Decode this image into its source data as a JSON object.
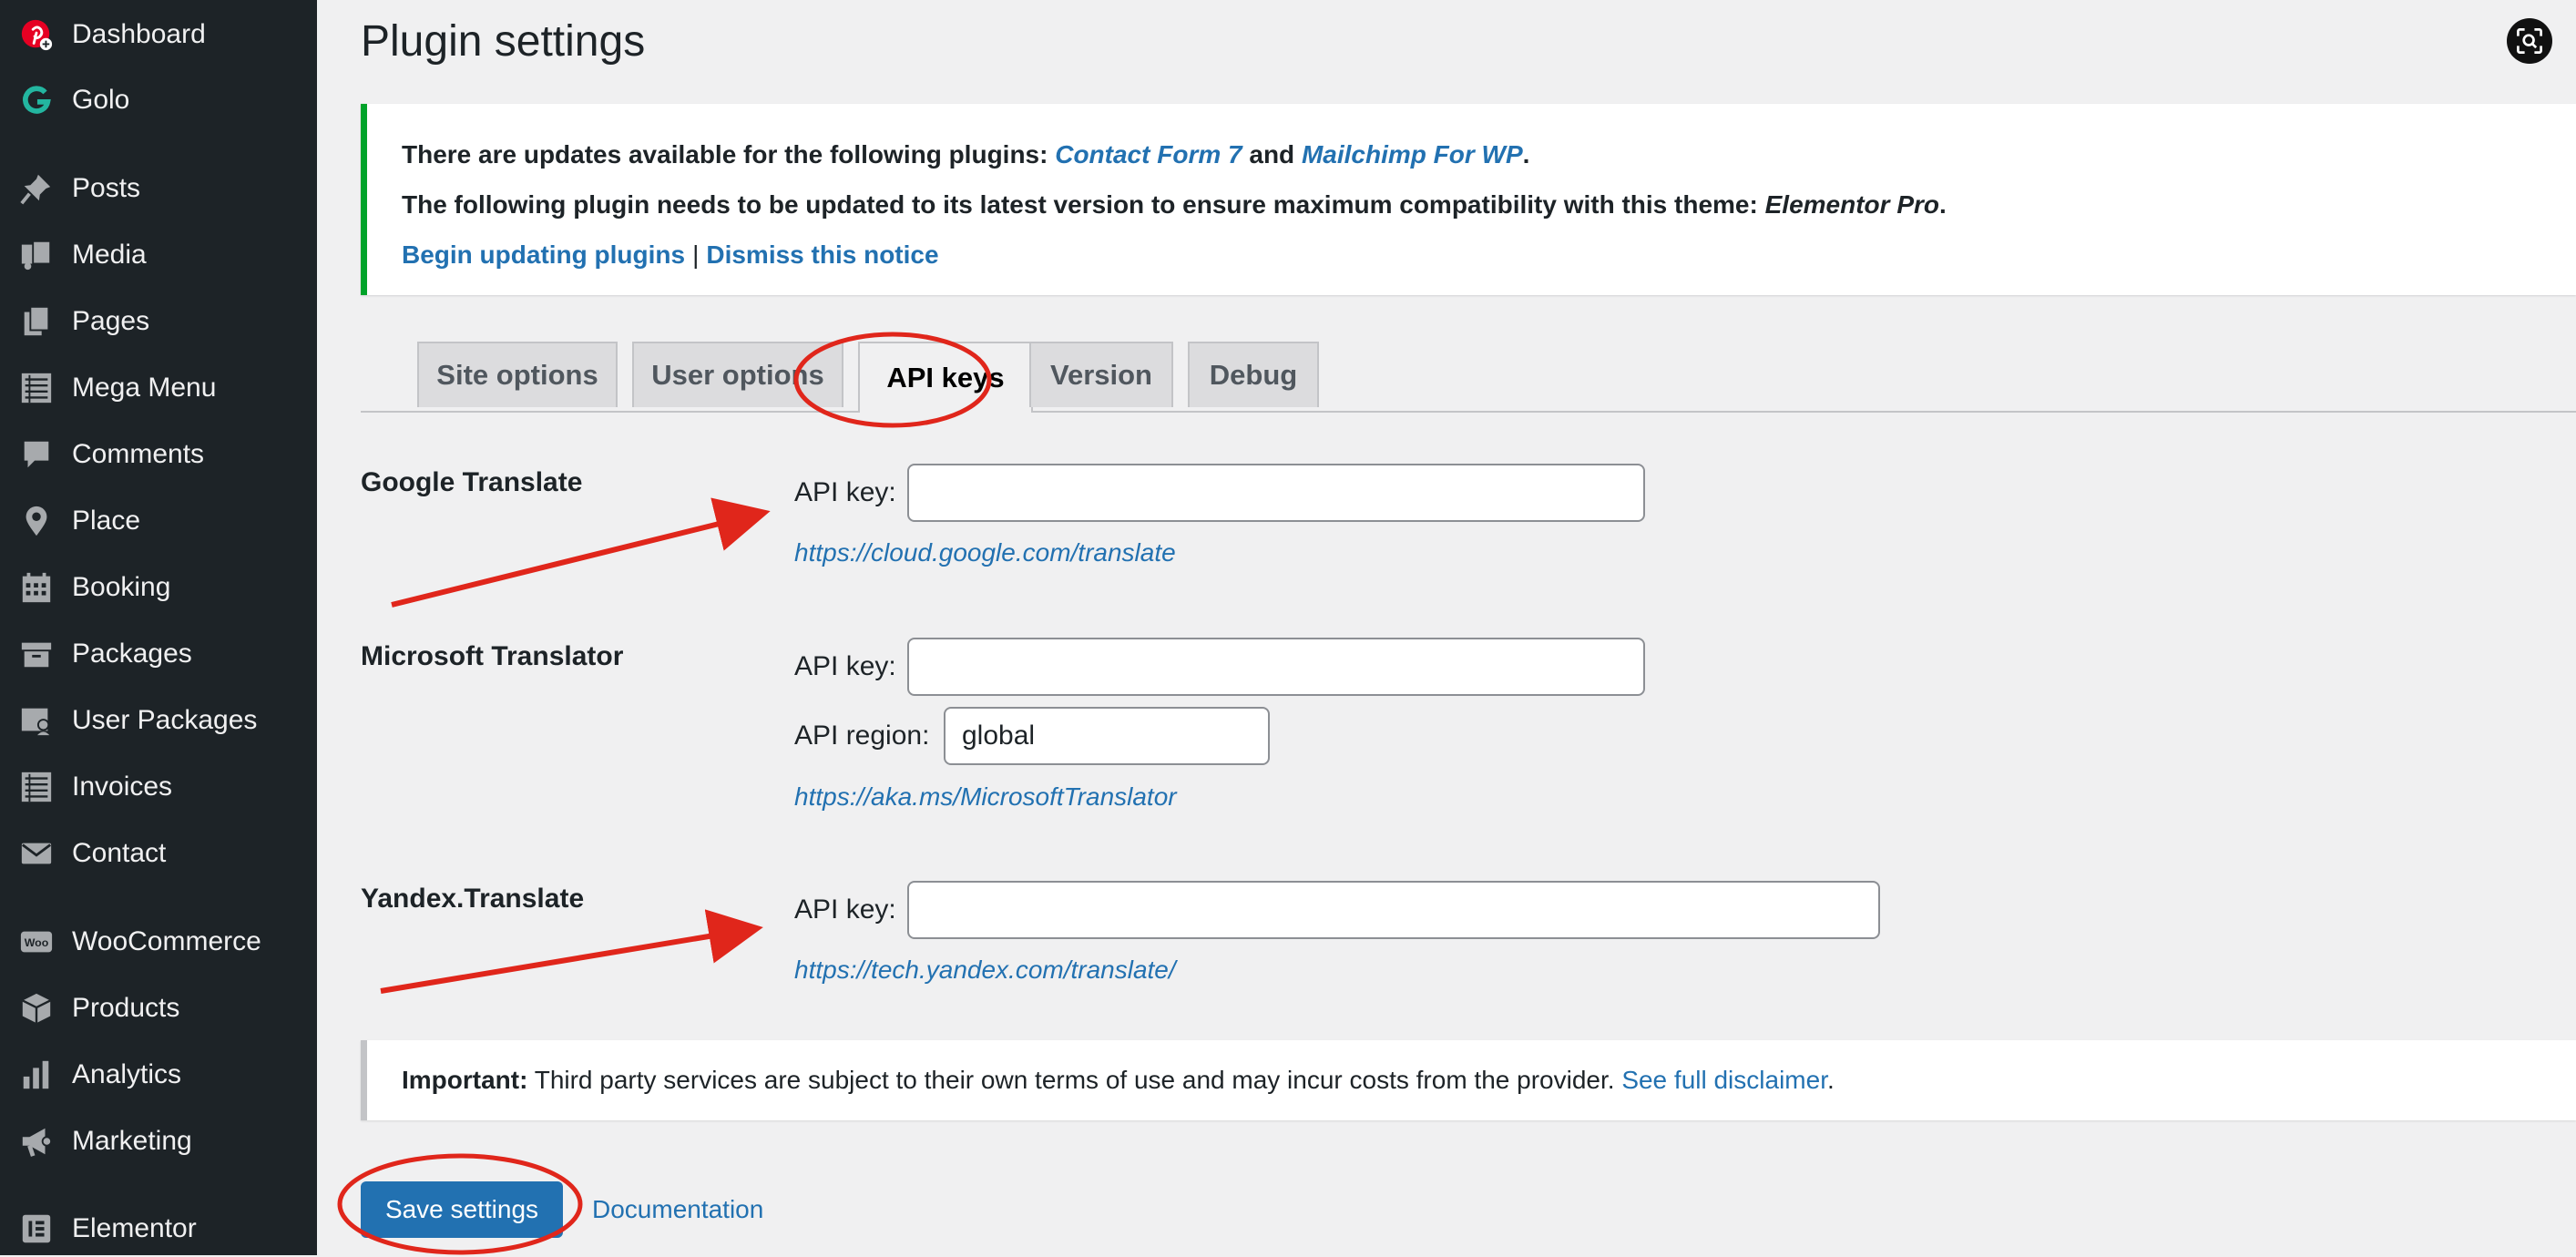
{
  "sidebar": {
    "items": [
      {
        "label": "Dashboard",
        "icon": "pinterest-logo-icon"
      },
      {
        "label": "Golo",
        "icon": "golo-logo-icon"
      },
      {
        "label": "Posts",
        "icon": "pin-icon"
      },
      {
        "label": "Media",
        "icon": "media-icon"
      },
      {
        "label": "Pages",
        "icon": "pages-icon"
      },
      {
        "label": "Mega Menu",
        "icon": "list-icon"
      },
      {
        "label": "Comments",
        "icon": "comment-icon"
      },
      {
        "label": "Place",
        "icon": "location-icon"
      },
      {
        "label": "Booking",
        "icon": "calendar-icon"
      },
      {
        "label": "Packages",
        "icon": "archive-icon"
      },
      {
        "label": "User Packages",
        "icon": "user-card-icon"
      },
      {
        "label": "Invoices",
        "icon": "list-icon"
      },
      {
        "label": "Contact",
        "icon": "email-icon"
      },
      {
        "label": "WooCommerce",
        "icon": "woo-icon",
        "icon_text": "Woo"
      },
      {
        "label": "Products",
        "icon": "box-icon"
      },
      {
        "label": "Analytics",
        "icon": "bar-chart-icon"
      },
      {
        "label": "Marketing",
        "icon": "megaphone-icon"
      },
      {
        "label": "Elementor",
        "icon": "elementor-icon"
      }
    ]
  },
  "header": {
    "title": "Plugin settings"
  },
  "notice": {
    "line1_prefix": "There are updates available for the following plugins: ",
    "line1_link1": "Contact Form 7",
    "line1_and": " and ",
    "line1_link2": "Mailchimp For WP",
    "line1_suffix": ".",
    "line2_prefix": "The following plugin needs to be updated to its latest version to ensure maximum compatibility with this theme: ",
    "line2_plugin": "Elementor Pro",
    "line2_suffix": ".",
    "begin_link": "Begin updating plugins",
    "separator": "|",
    "dismiss_link": "Dismiss this notice"
  },
  "tabs": [
    {
      "label": "Site options",
      "active": false
    },
    {
      "label": "User options",
      "active": false
    },
    {
      "label": "API keys",
      "active": true
    },
    {
      "label": "Version",
      "active": false
    },
    {
      "label": "Debug",
      "active": false
    }
  ],
  "google": {
    "title": "Google Translate",
    "key_label": "API key:",
    "key_value": "",
    "link": "https://cloud.google.com/translate"
  },
  "microsoft": {
    "title": "Microsoft Translator",
    "key_label": "API key:",
    "key_value": "",
    "region_label": "API region:",
    "region_value": "global",
    "link": "https://aka.ms/MicrosoftTranslator"
  },
  "yandex": {
    "title": "Yandex.Translate",
    "key_label": "API key:",
    "key_value": "",
    "link": "https://tech.yandex.com/translate/"
  },
  "disclaimer": {
    "bold": "Important:",
    "text": " Third party services are subject to their own terms of use and may incur costs from the provider. ",
    "link": "See full disclaimer",
    "suffix": "."
  },
  "footer": {
    "save_label": "Save settings",
    "doc_label": "Documentation"
  },
  "colors": {
    "sidebar_bg": "#1d2327",
    "accent": "#2271b1",
    "notice_success": "#00a32a",
    "annotation": "#e0261b"
  }
}
